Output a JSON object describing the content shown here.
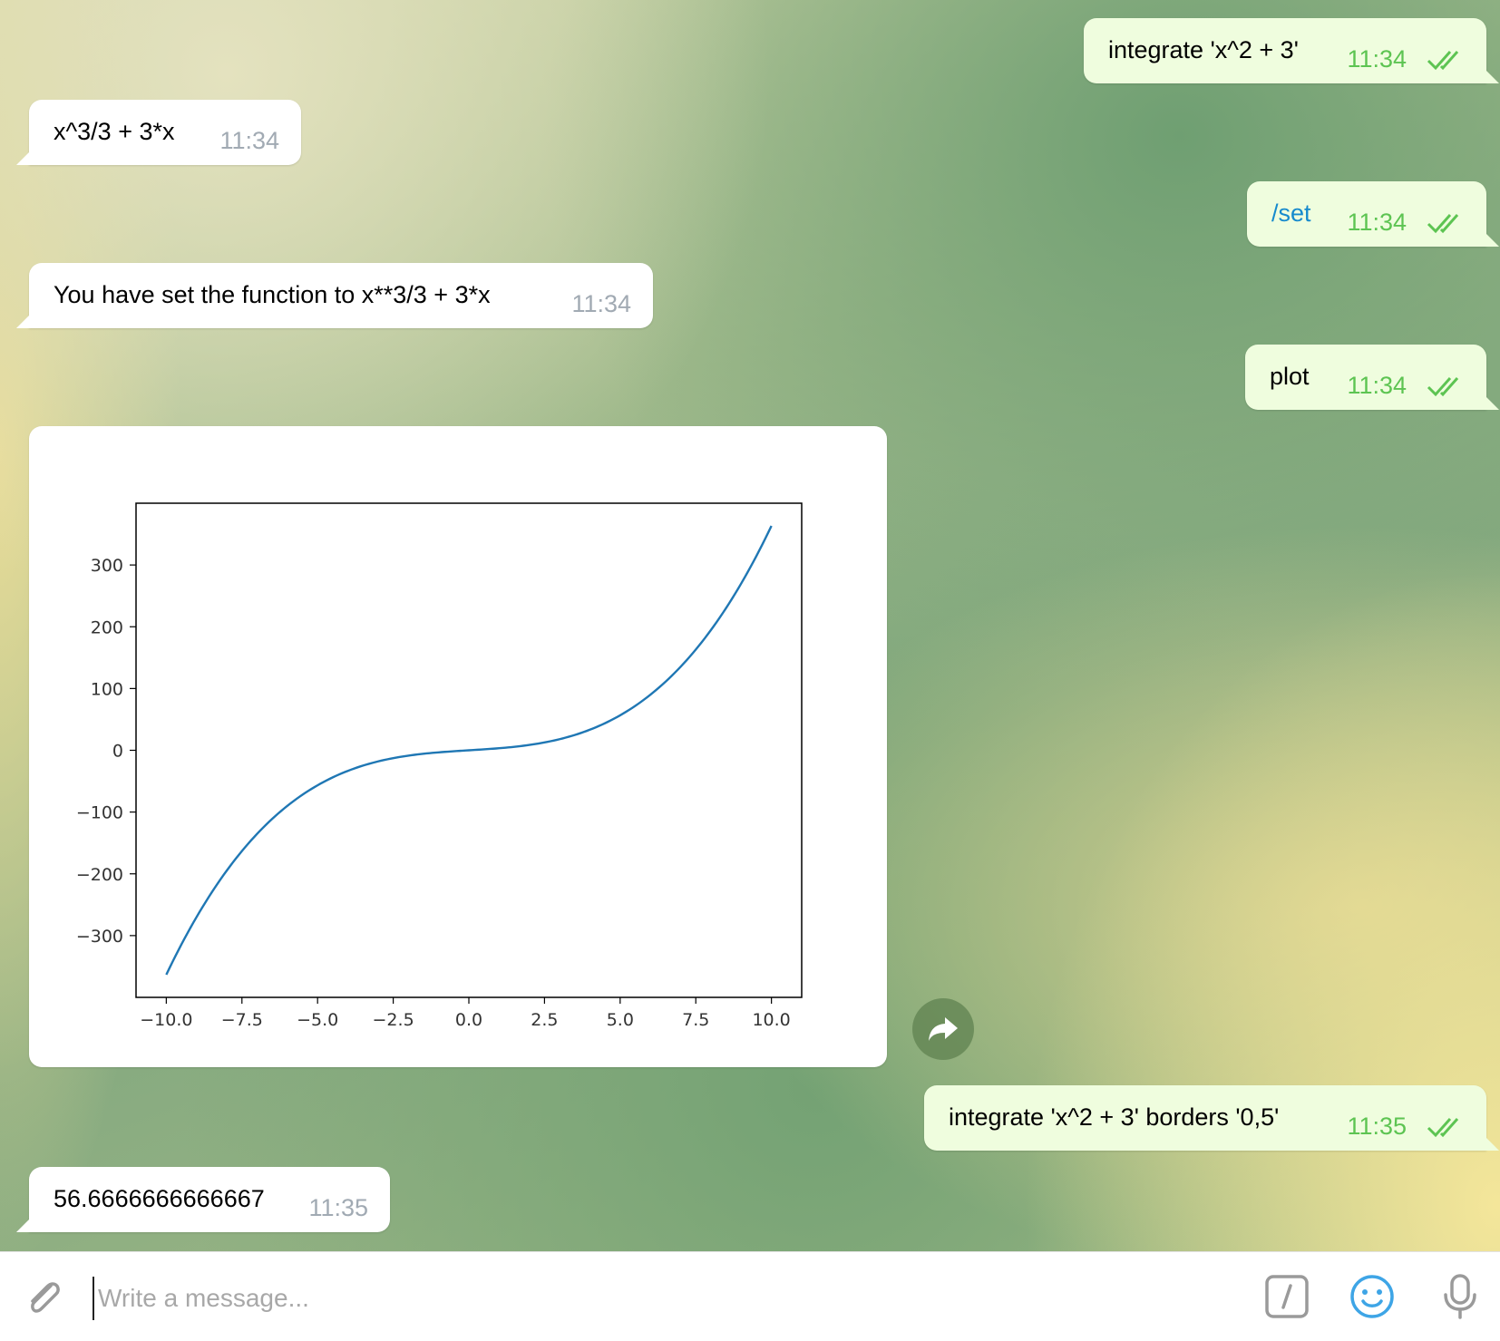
{
  "placeholder": "Write a message...",
  "messages": {
    "m1": {
      "text": "integrate 'x^2 + 3'",
      "time": "11:34"
    },
    "m2": {
      "text": "x^3/3 + 3*x",
      "time": "11:34"
    },
    "m3": {
      "text": "/set",
      "time": "11:34"
    },
    "m4": {
      "text": "You have set the function to x**3/3 + 3*x",
      "time": "11:34"
    },
    "m5": {
      "text": "plot",
      "time": "11:34"
    },
    "m6": {
      "text": "integrate  'x^2 + 3' borders '0,5'",
      "time": "11:35"
    },
    "m7": {
      "text": "56.6666666666667",
      "time": "11:35"
    }
  },
  "colors": {
    "outgoing_bubble": "#effdde",
    "incoming_bubble": "#ffffff",
    "read_check": "#5dc452",
    "command_link": "#168acd",
    "plot_line": "#1f77b4",
    "emoji_icon": "#3ea5e6"
  },
  "icons": [
    "double-check-icon",
    "forward-icon",
    "paperclip-icon",
    "slash-command-icon",
    "emoji-icon",
    "microphone-icon"
  ],
  "chart_data": {
    "type": "line",
    "function": "x**3/3 + 3*x",
    "x": [
      -10,
      -9,
      -8,
      -7,
      -6,
      -5,
      -4,
      -3,
      -2,
      -1,
      0,
      1,
      2,
      3,
      4,
      5,
      6,
      7,
      8,
      9,
      10
    ],
    "y": [
      -363.33,
      -270,
      -194.67,
      -135.33,
      -90,
      -56.67,
      -33.33,
      -18,
      -8.67,
      -3.33,
      0,
      3.33,
      8.67,
      18,
      33.33,
      56.67,
      90,
      135.33,
      194.67,
      270,
      363.33
    ],
    "xlim": [
      -11,
      11
    ],
    "ylim": [
      -400,
      400
    ],
    "xticks": [
      "−10.0",
      "−7.5",
      "−5.0",
      "−2.5",
      "0.0",
      "2.5",
      "5.0",
      "7.5",
      "10.0"
    ],
    "xtick_values": [
      -10,
      -7.5,
      -5,
      -2.5,
      0,
      2.5,
      5,
      7.5,
      10
    ],
    "yticks": [
      "300",
      "200",
      "100",
      "0",
      "−100",
      "−200",
      "−300"
    ],
    "ytick_values": [
      300,
      200,
      100,
      0,
      -100,
      -200,
      -300
    ],
    "grid": false,
    "title": "",
    "xlabel": "",
    "ylabel": ""
  }
}
